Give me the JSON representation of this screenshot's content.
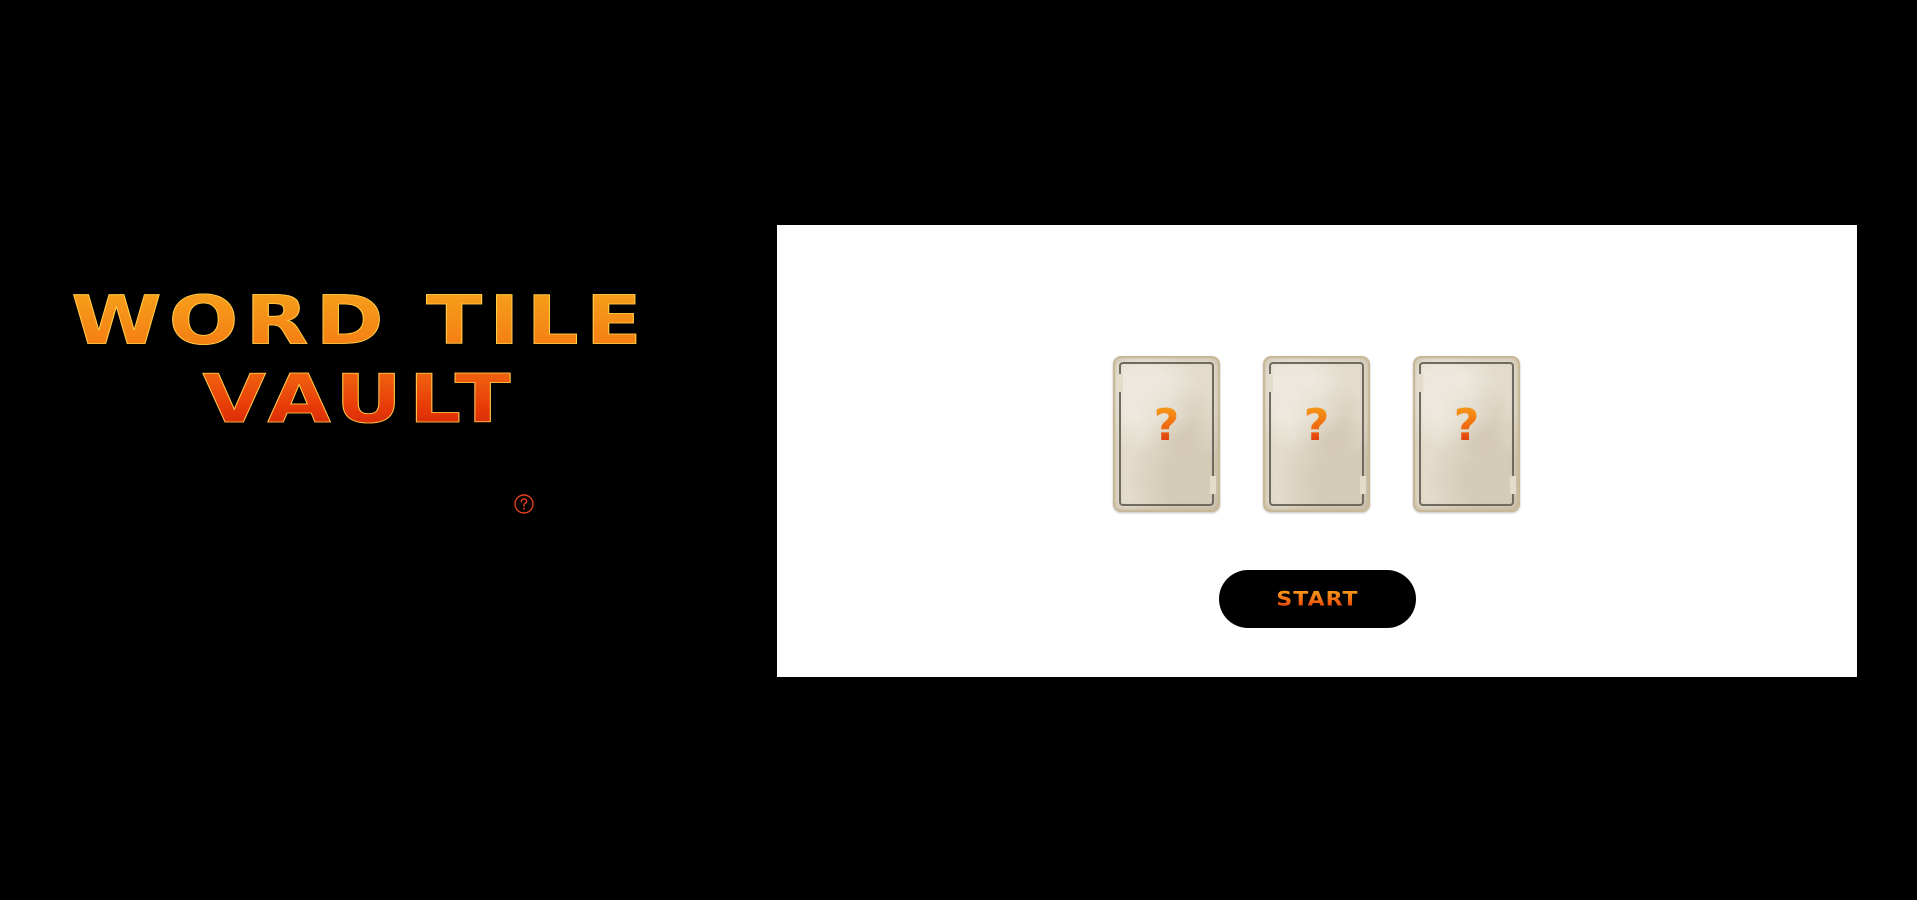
{
  "title": {
    "line1": "WORD TILE",
    "line2": "VAULT"
  },
  "help": {
    "icon": "question-circle-icon"
  },
  "game": {
    "cards": [
      {
        "symbol": "?",
        "state": "face-down"
      },
      {
        "symbol": "?",
        "state": "face-down"
      },
      {
        "symbol": "?",
        "state": "face-down"
      }
    ],
    "start_label": "START"
  },
  "colors": {
    "background": "#000000",
    "panel": "#ffffff",
    "accent_top": "#f7a51c",
    "accent_bottom": "#d4230a",
    "card_paper": "#e3dccb"
  }
}
